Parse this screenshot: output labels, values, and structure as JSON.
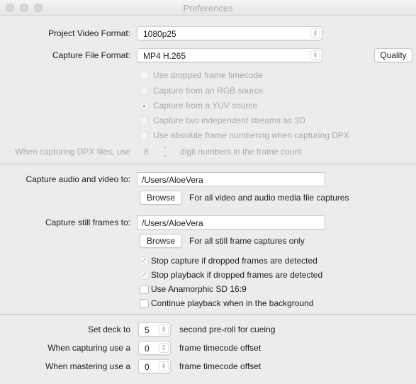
{
  "window": {
    "title": "Preferences"
  },
  "format": {
    "project_video_label": "Project Video Format:",
    "project_video_value": "1080p25",
    "capture_file_label": "Capture File Format:",
    "capture_file_value": "MP4 H.265",
    "quality_button": "Quality"
  },
  "options": {
    "dropped_timecode": "Use dropped frame timecode",
    "rgb_source": "Capture from an RGB source",
    "yuv_source": "Capture from a YUV source",
    "two_streams_3d": "Capture two independent streams as 3D",
    "absolute_numbering": "Use absolute frame numbering when capturing DPX"
  },
  "dpx": {
    "label": "When capturing DPX files, use",
    "digits": "8",
    "suffix": "digit numbers in the frame count"
  },
  "capture_av": {
    "label": "Capture audio and video to:",
    "path": "/Users/AloeVera",
    "browse": "Browse",
    "hint": "For all video and audio media file captures"
  },
  "capture_still": {
    "label": "Capture still frames to:",
    "path": "/Users/AloeVera",
    "browse": "Browse",
    "hint": "For all still frame captures only"
  },
  "checks": {
    "stop_capture": "Stop capture if dropped frames are detected",
    "stop_playback": "Stop playback if dropped frames are detected",
    "anamorphic": "Use Anamorphic SD 16:9",
    "continue_playback": "Continue playback when in the background"
  },
  "deck": {
    "set_deck_label": "Set deck to",
    "preroll_value": "5",
    "preroll_suffix": "second pre-roll for cueing",
    "capturing_label": "When capturing use a",
    "capturing_value": "0",
    "capturing_suffix": "frame timecode offset",
    "mastering_label": "When mastering use a",
    "mastering_value": "0",
    "mastering_suffix": "frame timecode offset"
  }
}
